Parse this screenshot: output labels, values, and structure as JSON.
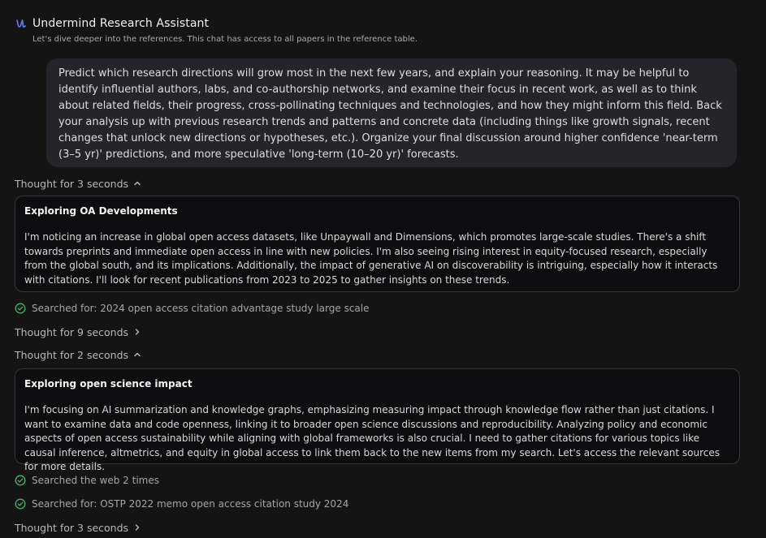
{
  "header": {
    "title": "Undermind Research Assistant",
    "subtitle": "Let's dive deeper into the references. This chat has access to all papers in the reference table."
  },
  "prompt": {
    "text": "Predict which research directions will grow most in the next few years, and explain your reasoning. It may be helpful to identify influential authors, labs, and co-authorship networks, and examine their focus in recent work, as well as to think about related fields, their progress, cross-pollinating techniques and technologies, and how they might inform this field. Back your analysis up with previous research trends and patterns and concrete data (including things like growth signals, recent changes that unlock new directions or hypotheses, etc.). Organize your final discussion around higher confidence 'near-term (3–5 yr)' predictions, and more speculative 'long-term (10–20 yr)' forecasts."
  },
  "thoughts": [
    {
      "label": "Thought for 3 seconds",
      "state": "expanded"
    },
    {
      "label": "Thought for 9 seconds",
      "state": "collapsed"
    },
    {
      "label": "Thought for 2 seconds",
      "state": "expanded"
    },
    {
      "label": "Thought for 3 seconds",
      "state": "collapsed"
    }
  ],
  "cards": [
    {
      "title": "Exploring OA Developments",
      "body": "I'm noticing an increase in global open access datasets, like Unpaywall and Dimensions, which promotes large-scale studies. There's a shift towards preprints and immediate open access in line with new policies. I'm also seeing rising interest in equity-focused research, especially from the global south, and its implications. Additionally, the impact of generative AI on discoverability is intriguing, especially how it interacts with citations. I'll look for recent publications from 2023 to 2025 to gather insights on these trends."
    },
    {
      "title": "Exploring open science impact",
      "body": "I'm focusing on AI summarization and knowledge graphs, emphasizing measuring impact through knowledge flow rather than just citations. I want to examine data and code openness, linking it to broader open science discussions and reproducibility. Analyzing policy and economic aspects of open access sustainability while aligning with global frameworks is also crucial. I need to gather citations for various topics like causal inference, altmetrics, and equity in global access to link them back to the new items from my search. Let's access the relevant sources for more details."
    }
  ],
  "searches": [
    {
      "label": "Searched for: 2024 open access citation advantage study large scale"
    },
    {
      "label": "Searched the web 2 times"
    },
    {
      "label": "Searched for: OSTP 2022 memo open access citation study 2024"
    }
  ],
  "colors": {
    "background": "#141414",
    "accent": "#7b6cf0",
    "check": "#3fb86a"
  },
  "icons": {
    "logo": "undermind-logo-icon",
    "check": "check-circle-icon",
    "expanded": "chevron-up-icon",
    "collapsed": "chevron-right-icon"
  }
}
